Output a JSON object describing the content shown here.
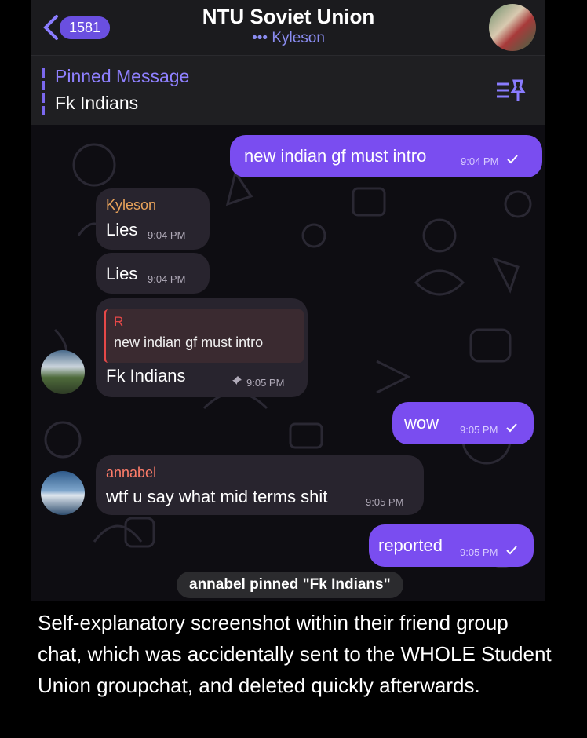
{
  "header": {
    "back_badge": "1581",
    "title": "NTU Soviet Union",
    "subtitle_dots": "•••",
    "subtitle": "Kyleson"
  },
  "pinned": {
    "label": "Pinned Message",
    "text": "Fk Indians"
  },
  "messages": [
    {
      "id": "m1",
      "direction": "out",
      "text": "new indian gf must intro",
      "time": "9:04 PM"
    },
    {
      "id": "m2",
      "direction": "in",
      "sender": "Kyleson",
      "text": "Lies",
      "time": "9:04 PM"
    },
    {
      "id": "m3",
      "direction": "in",
      "text": "Lies",
      "time": "9:04 PM"
    },
    {
      "id": "m4",
      "direction": "in",
      "reply_name": "R",
      "reply_text": "new indian gf must intro",
      "text": "Fk Indians",
      "time": "9:05 PM",
      "pinned": true
    },
    {
      "id": "m5",
      "direction": "out",
      "text": "wow",
      "time": "9:05 PM"
    },
    {
      "id": "m6",
      "direction": "in",
      "sender": "annabel",
      "text": "wtf u say what mid terms shit",
      "time": "9:05 PM"
    },
    {
      "id": "m7",
      "direction": "out",
      "text": "reported",
      "time": "9:05 PM"
    }
  ],
  "service_message": "annabel pinned \"Fk Indians\"",
  "caption": "Self-explanatory screenshot within their friend group chat, which was accidentally sent to the WHOLE Student Union groupchat, and deleted quickly afterwards.",
  "colors": {
    "accent": "#7a4df0",
    "incoming": "#28242e",
    "background": "#0e0d12"
  }
}
